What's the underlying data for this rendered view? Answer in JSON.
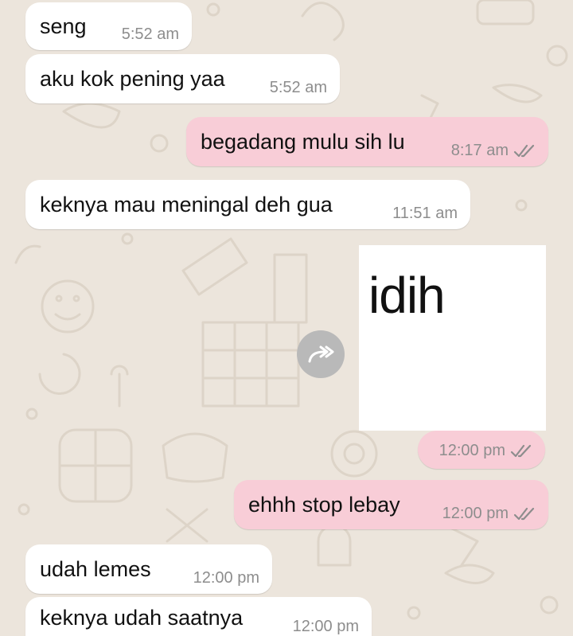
{
  "chat": {
    "messages": [
      {
        "text": "seng",
        "time": "5:52 am",
        "direction": "in"
      },
      {
        "text": "aku kok pening yaa",
        "time": "5:52 am",
        "direction": "in"
      },
      {
        "text": "begadang mulu sih lu",
        "time": "8:17 am",
        "direction": "out",
        "status": "read"
      },
      {
        "text": "keknya mau meningal deh gua",
        "time": "11:51 am",
        "direction": "in"
      },
      {
        "image_text": "idih",
        "time": "12:00 pm",
        "direction": "out",
        "status": "read"
      },
      {
        "text": "ehhh stop lebay",
        "time": "12:00 pm",
        "direction": "out",
        "status": "read"
      },
      {
        "text": "udah lemes",
        "time": "12:00 pm",
        "direction": "in"
      },
      {
        "text": "keknya udah saatnya",
        "time": "12:00 pm",
        "direction": "in"
      }
    ]
  },
  "icons": {
    "read_receipt": "double-check-icon",
    "forward": "forward-arrow-icon"
  },
  "colors": {
    "background": "#ece5dc",
    "incoming_bubble": "#ffffff",
    "outgoing_bubble": "#f8cdd7",
    "timestamp": "#8d8d8d"
  }
}
